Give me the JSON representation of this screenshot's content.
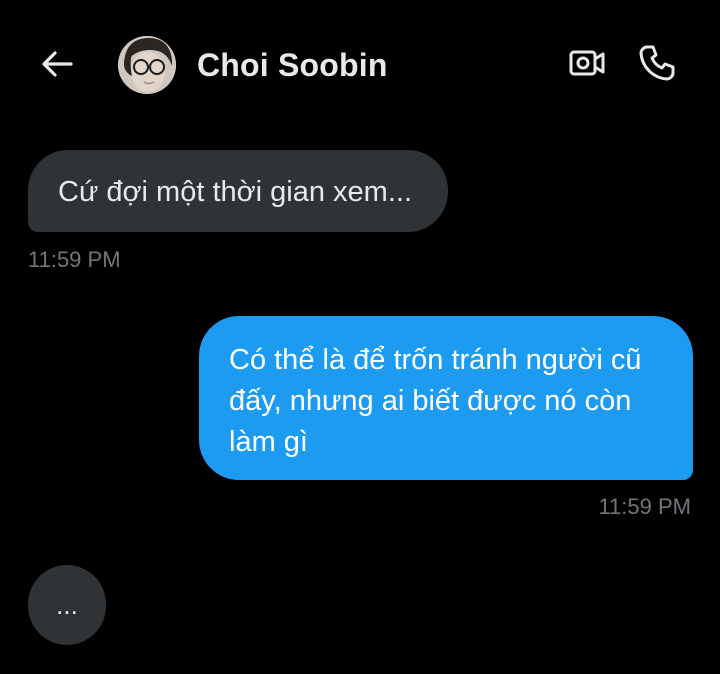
{
  "header": {
    "contact_name": "Choi Soobin",
    "icons": {
      "back": "arrow-left-icon",
      "video": "video-camera-icon",
      "call": "phone-icon"
    }
  },
  "messages": [
    {
      "direction": "incoming",
      "text": "Cứ đợi một thời gian xem...",
      "time": "11:59 PM"
    },
    {
      "direction": "outgoing",
      "text": "Có thể là để trốn tránh người cũ đấy, nhưng ai biết được nó còn làm gì",
      "time": "11:59 PM"
    }
  ],
  "typing_indicator": "...",
  "colors": {
    "background": "#000000",
    "incoming_bubble": "#2f3336",
    "outgoing_bubble": "#1d9bf0",
    "timestamp": "#71767b",
    "text": "#e7e9ea"
  }
}
